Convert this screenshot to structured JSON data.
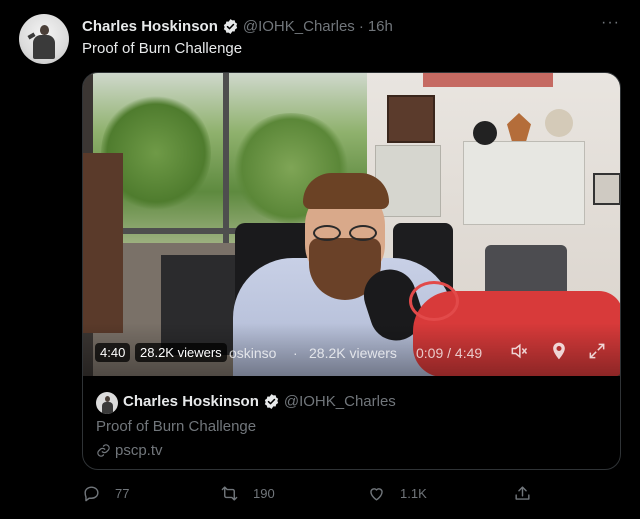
{
  "tweet": {
    "author_name": "Charles Hoskinson",
    "handle": "@IOHK_Charles",
    "separator": "·",
    "time": "16h",
    "more_label": "···",
    "text": "Proof of Burn Challenge",
    "verified_icon": "verified-badge-icon"
  },
  "video": {
    "duration": "4:40",
    "viewers_pill": "28.2K viewers",
    "broadcaster_fragment": "oskinso",
    "ctrl_separator": "·",
    "viewers_text": "28.2K viewers",
    "progress": "0:09 / 4:49",
    "icons": [
      "mute-icon",
      "location-pin-icon",
      "expand-icon"
    ]
  },
  "quote": {
    "author_name": "Charles Hoskinson",
    "handle": "@IOHK_Charles",
    "text": "Proof of Burn Challenge",
    "link": "pscp.tv"
  },
  "actions": {
    "reply_count": "77",
    "retweet_count": "190",
    "like_count": "1.1K",
    "icons": [
      "reply-icon",
      "retweet-icon",
      "like-icon",
      "share-icon"
    ]
  },
  "colors": {
    "background": "#000000",
    "primary_text": "#e7e9ea",
    "secondary_text": "#71767b",
    "border": "#2f3336",
    "verified": "#e7e9ea"
  }
}
